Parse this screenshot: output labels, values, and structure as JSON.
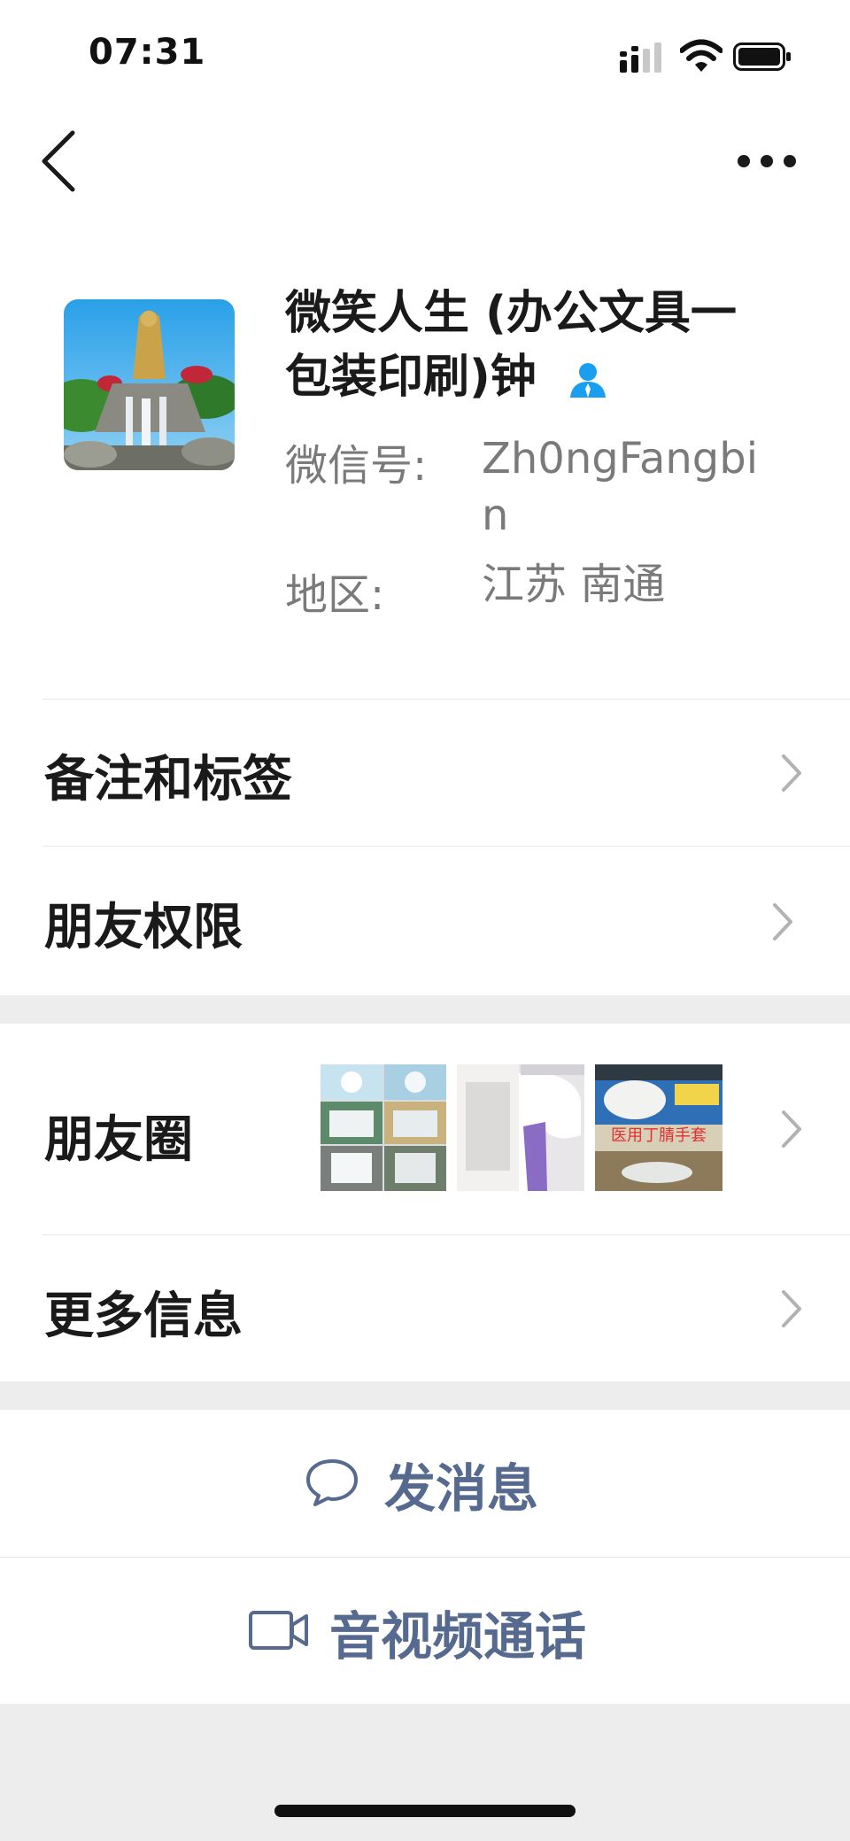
{
  "status_bar": {
    "time": "07:31",
    "signal_icon": "signal-bars-icon",
    "wifi_icon": "wifi-icon",
    "battery_icon": "battery-icon"
  },
  "nav": {
    "back_icon": "chevron-left-icon",
    "more_icon": "ellipsis-icon"
  },
  "profile": {
    "name": "微笑人生 (办公文具一包装印刷)钟",
    "name_line1": "微笑人生 (办公文具一",
    "name_line2": "包装印刷)钟",
    "wechat_id_label": "微信号:",
    "wechat_id_value": "Zh0ngFangbin",
    "wechat_id_line1": "Zh0ngFangbi",
    "wechat_id_line2": "n",
    "region_label": "地区:",
    "region_value": "江苏 南通",
    "avatar": "statue-waterfall-photo",
    "contact_icon": "person-icon"
  },
  "rows": {
    "remarks_tags": "备注和标签",
    "friend_permissions": "朋友权限",
    "moments": "朋友圈",
    "more_info": "更多信息"
  },
  "moments_thumbs": [
    {
      "name": "thumb-product-grid"
    },
    {
      "name": "thumb-thermometer"
    },
    {
      "name": "thumb-gloves-box",
      "overlay_text": "医用丁腈手套"
    }
  ],
  "actions": {
    "send_message": "发消息",
    "video_call": "音视频通话"
  },
  "colors": {
    "action_blue": "#56698f",
    "separator_gray": "#ededed",
    "contact_icon_blue": "#1a9ef0"
  }
}
